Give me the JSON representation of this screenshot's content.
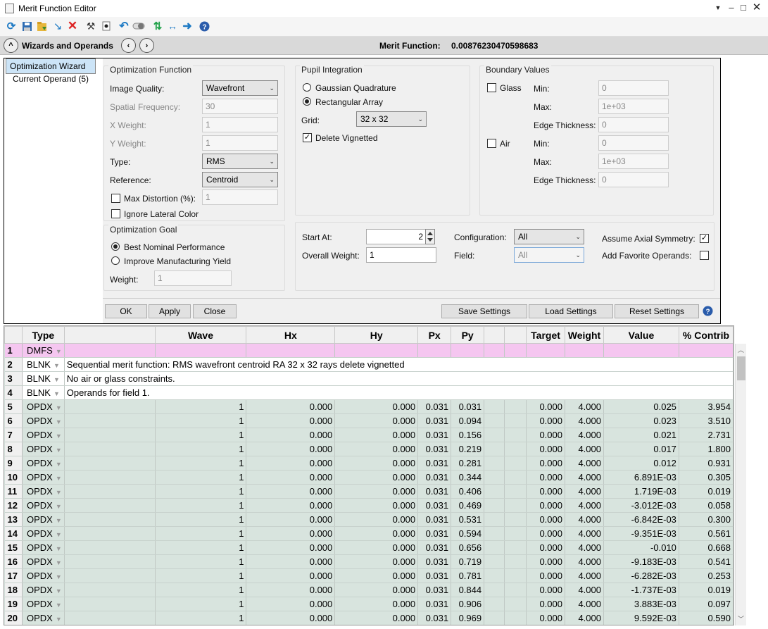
{
  "window": {
    "title": "Merit Function Editor"
  },
  "wizard_bar": {
    "label": "Wizards and Operands",
    "mf_label": "Merit Function:",
    "mf_value": "0.00876230470598683"
  },
  "nav": {
    "items": [
      "Optimization Wizard",
      "Current Operand (5)"
    ]
  },
  "opt_function": {
    "title": "Optimization Function",
    "image_quality_label": "Image Quality:",
    "image_quality": "Wavefront",
    "spatial_freq_label": "Spatial Frequency:",
    "spatial_freq": "30",
    "x_weight_label": "X Weight:",
    "x_weight": "1",
    "y_weight_label": "Y Weight:",
    "y_weight": "1",
    "type_label": "Type:",
    "type": "RMS",
    "reference_label": "Reference:",
    "reference": "Centroid",
    "max_distortion_label": "Max Distortion (%):",
    "max_distortion": "1",
    "ignore_lateral_label": "Ignore Lateral Color"
  },
  "pupil": {
    "title": "Pupil Integration",
    "gaussian_label": "Gaussian Quadrature",
    "rectangular_label": "Rectangular Array",
    "grid_label": "Grid:",
    "grid": "32 x 32",
    "delete_vignetted_label": "Delete Vignetted"
  },
  "boundary": {
    "title": "Boundary Values",
    "glass_label": "Glass",
    "air_label": "Air",
    "min_label": "Min:",
    "max_label": "Max:",
    "edge_label": "Edge Thickness:",
    "glass_min": "0",
    "glass_max": "1e+03",
    "glass_edge": "0",
    "air_min": "0",
    "air_max": "1e+03",
    "air_edge": "0"
  },
  "goal": {
    "title": "Optimization Goal",
    "best_label": "Best Nominal Performance",
    "improve_label": "Improve Manufacturing Yield",
    "weight_label": "Weight:",
    "weight": "1"
  },
  "settings": {
    "start_at_label": "Start At:",
    "start_at": "2",
    "overall_weight_label": "Overall Weight:",
    "overall_weight": "1",
    "configuration_label": "Configuration:",
    "configuration": "All",
    "field_label": "Field:",
    "field": "All",
    "axial_label": "Assume Axial Symmetry:",
    "favorite_label": "Add Favorite Operands:"
  },
  "buttons": {
    "ok": "OK",
    "apply": "Apply",
    "close": "Close",
    "save": "Save Settings",
    "load": "Load Settings",
    "reset": "Reset Settings"
  },
  "table": {
    "headers": [
      "Type",
      "Wave",
      "Hx",
      "Hy",
      "Px",
      "Py",
      "",
      "",
      "Target",
      "Weight",
      "Value",
      "% Contrib"
    ],
    "rows": [
      {
        "n": "1",
        "type": "DMFS",
        "comment": ""
      },
      {
        "n": "2",
        "type": "BLNK",
        "comment": "Sequential merit function: RMS wavefront centroid RA 32 x 32 rays delete vignetted"
      },
      {
        "n": "3",
        "type": "BLNK",
        "comment": "No air or glass constraints."
      },
      {
        "n": "4",
        "type": "BLNK",
        "comment": "Operands for field 1."
      },
      {
        "n": "5",
        "type": "OPDX",
        "cells": [
          "",
          "1",
          "0.000",
          "0.000",
          "0.031",
          "0.031",
          "",
          "",
          "0.000",
          "4.000",
          "0.025",
          "3.954"
        ]
      },
      {
        "n": "6",
        "type": "OPDX",
        "cells": [
          "",
          "1",
          "0.000",
          "0.000",
          "0.031",
          "0.094",
          "",
          "",
          "0.000",
          "4.000",
          "0.023",
          "3.510"
        ]
      },
      {
        "n": "7",
        "type": "OPDX",
        "cells": [
          "",
          "1",
          "0.000",
          "0.000",
          "0.031",
          "0.156",
          "",
          "",
          "0.000",
          "4.000",
          "0.021",
          "2.731"
        ]
      },
      {
        "n": "8",
        "type": "OPDX",
        "cells": [
          "",
          "1",
          "0.000",
          "0.000",
          "0.031",
          "0.219",
          "",
          "",
          "0.000",
          "4.000",
          "0.017",
          "1.800"
        ]
      },
      {
        "n": "9",
        "type": "OPDX",
        "cells": [
          "",
          "1",
          "0.000",
          "0.000",
          "0.031",
          "0.281",
          "",
          "",
          "0.000",
          "4.000",
          "0.012",
          "0.931"
        ]
      },
      {
        "n": "10",
        "type": "OPDX",
        "cells": [
          "",
          "1",
          "0.000",
          "0.000",
          "0.031",
          "0.344",
          "",
          "",
          "0.000",
          "4.000",
          "6.891E-03",
          "0.305"
        ]
      },
      {
        "n": "11",
        "type": "OPDX",
        "cells": [
          "",
          "1",
          "0.000",
          "0.000",
          "0.031",
          "0.406",
          "",
          "",
          "0.000",
          "4.000",
          "1.719E-03",
          "0.019"
        ]
      },
      {
        "n": "12",
        "type": "OPDX",
        "cells": [
          "",
          "1",
          "0.000",
          "0.000",
          "0.031",
          "0.469",
          "",
          "",
          "0.000",
          "4.000",
          "-3.012E-03",
          "0.058"
        ]
      },
      {
        "n": "13",
        "type": "OPDX",
        "cells": [
          "",
          "1",
          "0.000",
          "0.000",
          "0.031",
          "0.531",
          "",
          "",
          "0.000",
          "4.000",
          "-6.842E-03",
          "0.300"
        ]
      },
      {
        "n": "14",
        "type": "OPDX",
        "cells": [
          "",
          "1",
          "0.000",
          "0.000",
          "0.031",
          "0.594",
          "",
          "",
          "0.000",
          "4.000",
          "-9.351E-03",
          "0.561"
        ]
      },
      {
        "n": "15",
        "type": "OPDX",
        "cells": [
          "",
          "1",
          "0.000",
          "0.000",
          "0.031",
          "0.656",
          "",
          "",
          "0.000",
          "4.000",
          "-0.010",
          "0.668"
        ]
      },
      {
        "n": "16",
        "type": "OPDX",
        "cells": [
          "",
          "1",
          "0.000",
          "0.000",
          "0.031",
          "0.719",
          "",
          "",
          "0.000",
          "4.000",
          "-9.183E-03",
          "0.541"
        ]
      },
      {
        "n": "17",
        "type": "OPDX",
        "cells": [
          "",
          "1",
          "0.000",
          "0.000",
          "0.031",
          "0.781",
          "",
          "",
          "0.000",
          "4.000",
          "-6.282E-03",
          "0.253"
        ]
      },
      {
        "n": "18",
        "type": "OPDX",
        "cells": [
          "",
          "1",
          "0.000",
          "0.000",
          "0.031",
          "0.844",
          "",
          "",
          "0.000",
          "4.000",
          "-1.737E-03",
          "0.019"
        ]
      },
      {
        "n": "19",
        "type": "OPDX",
        "cells": [
          "",
          "1",
          "0.000",
          "0.000",
          "0.031",
          "0.906",
          "",
          "",
          "0.000",
          "4.000",
          "3.883E-03",
          "0.097"
        ]
      },
      {
        "n": "20",
        "type": "OPDX",
        "cells": [
          "",
          "1",
          "0.000",
          "0.000",
          "0.031",
          "0.969",
          "",
          "",
          "0.000",
          "4.000",
          "9.592E-03",
          "0.590"
        ]
      }
    ]
  }
}
